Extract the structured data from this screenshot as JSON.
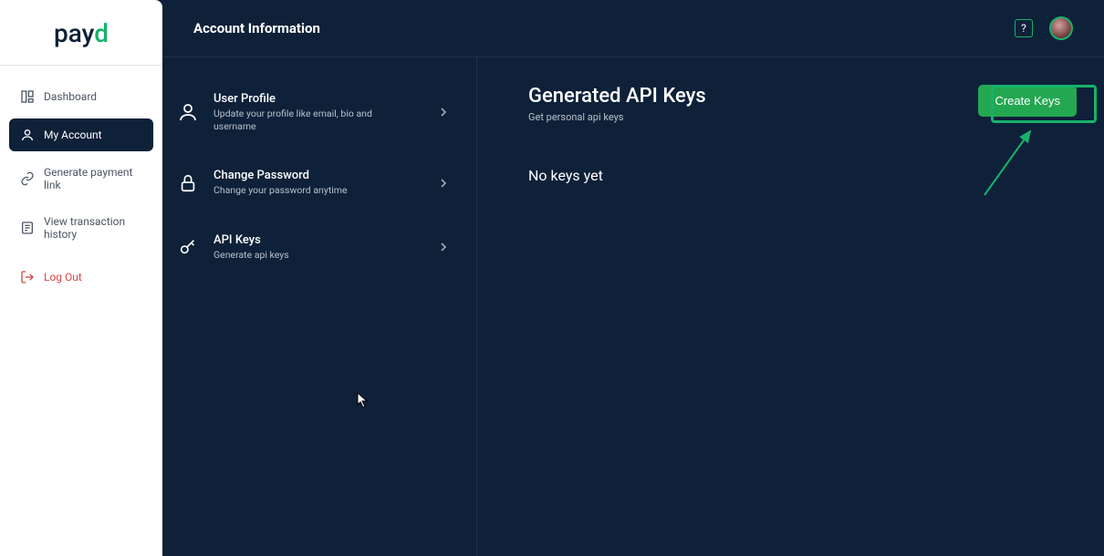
{
  "brand": {
    "name_part1": "pay",
    "name_part2": "d"
  },
  "sidebar": {
    "items": [
      {
        "label": "Dashboard"
      },
      {
        "label": "My Account"
      },
      {
        "label": "Generate payment link"
      },
      {
        "label": "View transaction history"
      },
      {
        "label": "Log Out"
      }
    ]
  },
  "header": {
    "title": "Account Information",
    "help": "?"
  },
  "settings": [
    {
      "title": "User Profile",
      "subtitle": "Update your profile like email, bio and username"
    },
    {
      "title": "Change Password",
      "subtitle": "Change your password anytime"
    },
    {
      "title": "API Keys",
      "subtitle": "Generate api keys"
    }
  ],
  "detail": {
    "title": "Generated API Keys",
    "subtitle": "Get personal api keys",
    "create_label": "Create Keys",
    "empty": "No keys yet"
  }
}
